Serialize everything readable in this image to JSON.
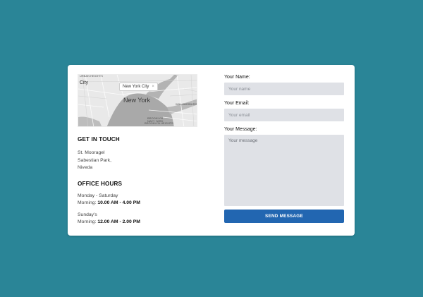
{
  "map": {
    "area_label": "URBAN HEIGHTS",
    "city_small": "City",
    "pin_label": "New York City",
    "pin_close_icon": "close-icon",
    "city_big": "New York",
    "district_label": "WILLIAMSBURG",
    "lower_label": "BROOKLYN NAVY YARD",
    "heights_label": "BROOKLYN HEIGHTS"
  },
  "contact": {
    "title": "GET IN TOUCH",
    "address": [
      "St. Mooragel",
      "Sabestian Park,",
      "Niveda"
    ]
  },
  "hours": {
    "title": "OFFICE HOURS",
    "blocks": [
      {
        "day": "Monday - Saturday",
        "prefix": "Morning: ",
        "time": "10.00 AM - 4.00 PM"
      },
      {
        "day": "Sunday's",
        "prefix": "Morning: ",
        "time": "12.00 AM - 2.00 PM"
      }
    ]
  },
  "form": {
    "name_label": "Your Name:",
    "name_placeholder": "Your name",
    "email_label": "Your Email:",
    "email_placeholder": "Your email",
    "message_label": "Your Message:",
    "message_placeholder": "Your message",
    "submit_label": "SEND MESSAGE"
  },
  "colors": {
    "background": "#2a8597",
    "card": "#ffffff",
    "field": "#dfe1e6",
    "button": "#2266b1"
  }
}
